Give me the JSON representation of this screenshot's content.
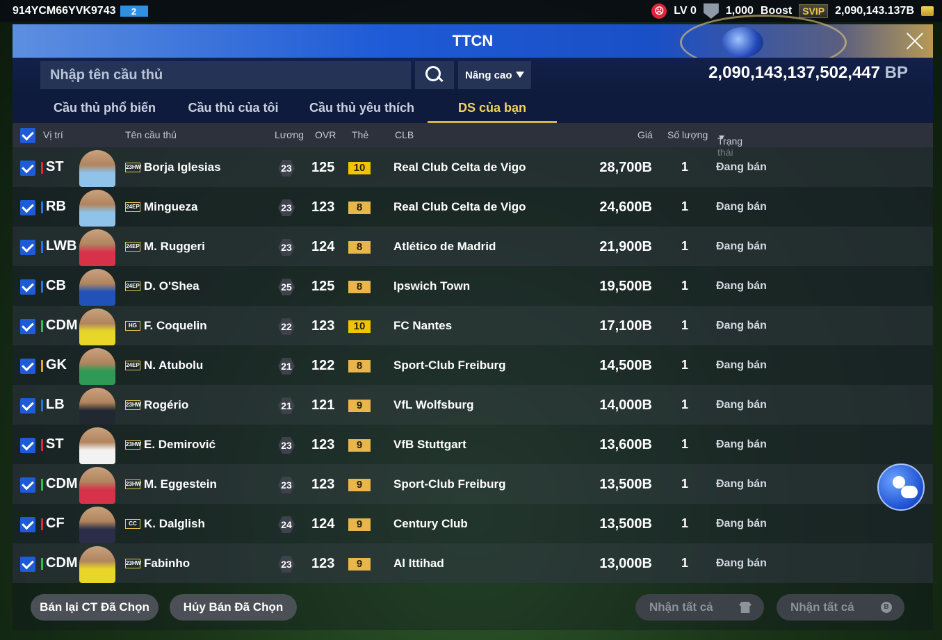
{
  "topbar": {
    "user_id": "914YCM66YVK9743",
    "server": "2",
    "level": "LV 0",
    "points": "1,000",
    "boost_label": "Boost",
    "svip_label": "SVIP",
    "currency": "2,090,143.137B"
  },
  "header": {
    "title": "TTCN",
    "search_placeholder": "Nhập tên cầu thủ",
    "advanced_label": "Nâng cao",
    "bp_amount": "2,090,143,137,502,447",
    "bp_unit": "BP"
  },
  "tabs": [
    {
      "label": "Cầu thủ phổ biến"
    },
    {
      "label": "Cầu thủ của tôi"
    },
    {
      "label": "Cầu thủ yêu thích"
    },
    {
      "label": "DS của bạn"
    }
  ],
  "table": {
    "headers": {
      "position": "Vị trí",
      "name": "Tên cầu thủ",
      "salary": "Lương",
      "ovr": "OVR",
      "card": "Thẻ",
      "club": "CLB",
      "price": "Giá",
      "quantity": "Số lượng",
      "status": "Trạng thái"
    },
    "rows": [
      {
        "pos": "ST",
        "pos_color": "#e0243a",
        "season": "23HW",
        "name": "Borja Iglesias",
        "salary": "23",
        "ovr": "125",
        "grade": "10",
        "club": "Real Club Celta de Vigo",
        "price": "28,700B",
        "qty": "1",
        "status": "Đang bán",
        "kit": "#8fc3ea"
      },
      {
        "pos": "RB",
        "pos_color": "#1e78e0",
        "season": "24EP",
        "name": "Mingueza",
        "salary": "23",
        "ovr": "123",
        "grade": "8",
        "club": "Real Club Celta de Vigo",
        "price": "24,600B",
        "qty": "1",
        "status": "Đang bán",
        "kit": "#8fc3ea"
      },
      {
        "pos": "LWB",
        "pos_color": "#1e78e0",
        "season": "24EP",
        "name": "M. Ruggeri",
        "salary": "23",
        "ovr": "124",
        "grade": "8",
        "club": "Atlético de Madrid",
        "price": "21,900B",
        "qty": "1",
        "status": "Đang bán",
        "kit": "#d8324a"
      },
      {
        "pos": "CB",
        "pos_color": "#1e78e0",
        "season": "24EP",
        "name": "D. O'Shea",
        "salary": "25",
        "ovr": "125",
        "grade": "8",
        "club": "Ipswich Town",
        "price": "19,500B",
        "qty": "1",
        "status": "Đang bán",
        "kit": "#2052b8"
      },
      {
        "pos": "CDM",
        "pos_color": "#2fbf4a",
        "season": "HG",
        "name": "F. Coquelin",
        "salary": "22",
        "ovr": "123",
        "grade": "10",
        "club": "FC Nantes",
        "price": "17,100B",
        "qty": "1",
        "status": "Đang bán",
        "kit": "#e8d728"
      },
      {
        "pos": "GK",
        "pos_color": "#e8a228",
        "season": "24EP",
        "name": "N. Atubolu",
        "salary": "21",
        "ovr": "122",
        "grade": "8",
        "club": "Sport-Club Freiburg",
        "price": "14,500B",
        "qty": "1",
        "status": "Đang bán",
        "kit": "#2f9a56"
      },
      {
        "pos": "LB",
        "pos_color": "#1e78e0",
        "season": "23HW",
        "name": "Rogério",
        "salary": "21",
        "ovr": "121",
        "grade": "9",
        "club": "VfL Wolfsburg",
        "price": "14,000B",
        "qty": "1",
        "status": "Đang bán",
        "kit": "#222831"
      },
      {
        "pos": "ST",
        "pos_color": "#e0243a",
        "season": "23HW",
        "name": "E. Demirović",
        "salary": "23",
        "ovr": "123",
        "grade": "9",
        "club": "VfB Stuttgart",
        "price": "13,600B",
        "qty": "1",
        "status": "Đang bán",
        "kit": "#f2f2f2"
      },
      {
        "pos": "CDM",
        "pos_color": "#2fbf4a",
        "season": "23HW",
        "name": "M. Eggestein",
        "salary": "23",
        "ovr": "123",
        "grade": "9",
        "club": "Sport-Club Freiburg",
        "price": "13,500B",
        "qty": "1",
        "status": "Đang bán",
        "kit": "#d8324a"
      },
      {
        "pos": "CF",
        "pos_color": "#e0243a",
        "season": "CC",
        "name": "K. Dalglish",
        "salary": "24",
        "ovr": "124",
        "grade": "9",
        "club": "Century Club",
        "price": "13,500B",
        "qty": "1",
        "status": "Đang bán",
        "kit": "#2a2e48"
      },
      {
        "pos": "CDM",
        "pos_color": "#2fbf4a",
        "season": "23HW",
        "name": "Fabinho",
        "salary": "23",
        "ovr": "123",
        "grade": "9",
        "club": "Al Ittihad",
        "price": "13,000B",
        "qty": "1",
        "status": "Đang bán",
        "kit": "#e8d728"
      }
    ]
  },
  "footer": {
    "resell_label": "Bán lại CT Đã Chọn",
    "cancel_label": "Hủy Bán Đã Chọn",
    "claim_all_players_label": "Nhận tất cả",
    "claim_all_coins_label": "Nhận tất cả",
    "coin_glyph": "B"
  },
  "colors": {
    "grade_10": "#f0c400",
    "grade_other": "#e8b64a",
    "accent": "#1e5bd6",
    "tab_active": "#f4d35e"
  }
}
